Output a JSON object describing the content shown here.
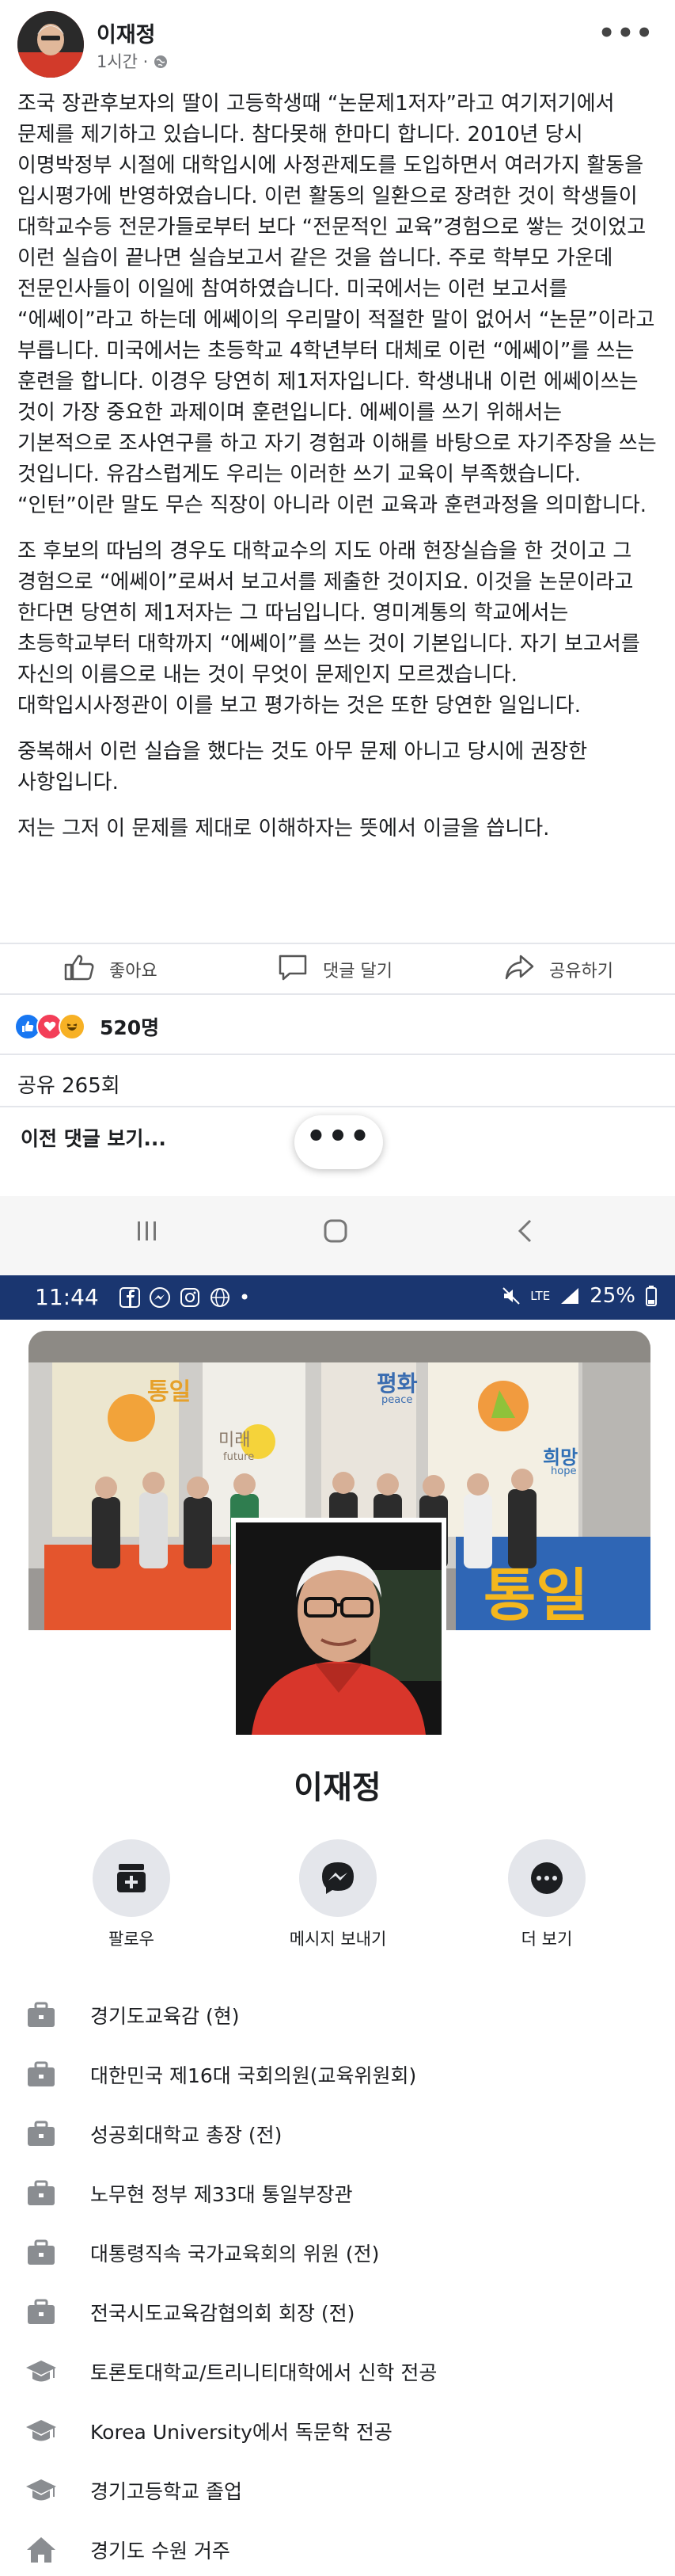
{
  "post": {
    "author": "이재정",
    "meta": "1시간 · ",
    "paragraphs": [
      "조국 장관후보자의 딸이 고등학생때 “논문제1저자”라고 여기저기에서 문제를 제기하고 있습니다. 참다못해 한마디 합니다. 2010년 당시 이명박정부 시절에 대학입시에 사정관제도를 도입하면서 여러가지 활동을 입시평가에 반영하였습니다. 이런 활동의 일환으로 장려한 것이 학생들이 대학교수등 전문가들로부터 보다 “전문적인 교육”경험으로 쌓는 것이었고 이런 실습이 끝나면 실습보고서 같은 것을 씁니다. 주로 학부모 가운데 전문인사들이 이일에 참여하였습니다. 미국에서는 이런 보고서를 “에쎄이”라고 하는데 에쎄이의 우리말이 적절한 말이 없어서 “논문”이라고 부릅니다. 미국에서는 초등학교 4학년부터 대체로 이런 “에쎄이”를 쓰는 훈련을 합니다. 이경우 당연히 제1저자입니다. 학생내내 이런 에쎄이쓰는 것이 가장 중요한 과제이며 훈련입니다. 에쎄이를 쓰기 위해서는 기본적으로 조사연구를 하고 자기 경험과 이해를 바탕으로 자기주장을 쓰는 것입니다. 유감스럽게도 우리는 이러한 쓰기 교육이 부족했습니다. “인턴”이란 말도 무슨 직장이 아니라 이런 교육과 훈련과정을 의미합니다.",
      "조 후보의 따님의 경우도 대학교수의 지도 아래 현장실습을 한 것이고 그 경험으로 “에쎄이”로써서 보고서를 제출한 것이지요. 이것을 논문이라고 한다면 당연히 제1저자는 그 따님입니다. 영미계통의 학교에서는 초등학교부터 대학까지 “에쎄이”를 쓰는 것이 기본입니다. 자기 보고서를 자신의 이름으로 내는 것이 무엇이 문제인지 모르겠습니다. 대학입시사정관이 이를 보고 평가하는 것은 또한 당연한 일입니다.",
      "중복해서 이런 실습을 했다는 것도 아무 문제 아니고 당시에 권장한 사항입니다.",
      "저는 그저 이 문제를 제대로 이해하자는 뜻에서 이글을 씁니다."
    ],
    "actions": {
      "like": "좋아요",
      "comment": "댓글 달기",
      "share": "공유하기"
    },
    "reaction_count": "520명",
    "share_count": "공유 265회",
    "prev_comments": "이전 댓글 보기...",
    "more_label": "•••"
  },
  "status_bar": {
    "time": "11:44",
    "battery": "25%",
    "network": "LTE"
  },
  "profile": {
    "name": "이재정",
    "buttons": {
      "follow": "팔로우",
      "message": "메시지 보내기",
      "more": "더 보기"
    },
    "cover_banner": {
      "left": "통일",
      "center": "평화",
      "center_sub": "peace",
      "right": "희망",
      "right_sub": "hope",
      "mid": "미래",
      "mid_sub": "future",
      "bottom": "통일"
    },
    "info": [
      {
        "icon": "briefcase-icon",
        "text": "경기도교육감 (현)"
      },
      {
        "icon": "briefcase-icon",
        "text": "대한민국 제16대 국회의원(교육위원회)"
      },
      {
        "icon": "briefcase-icon",
        "text": "성공회대학교 총장 (전)"
      },
      {
        "icon": "briefcase-icon",
        "text": "노무현 정부 제33대 통일부장관"
      },
      {
        "icon": "briefcase-icon",
        "text": "대통령직속 국가교육회의 위원 (전)"
      },
      {
        "icon": "briefcase-icon",
        "text": "전국시도교육감협의회 회장 (전)"
      },
      {
        "icon": "graduation-cap-icon",
        "text": "토론토대학교/트리니티대학에서 신학 전공"
      },
      {
        "icon": "graduation-cap-icon",
        "text": "Korea University에서 독문학 전공"
      },
      {
        "icon": "graduation-cap-icon",
        "text": "경기고등학교 졸업"
      },
      {
        "icon": "home-icon",
        "text": "경기도 수원 거주"
      }
    ]
  },
  "colors": {
    "facebook_blue": "#1877f2",
    "status_bar": "#1a3670",
    "text": "#1c1e21",
    "muted": "#65676b"
  }
}
